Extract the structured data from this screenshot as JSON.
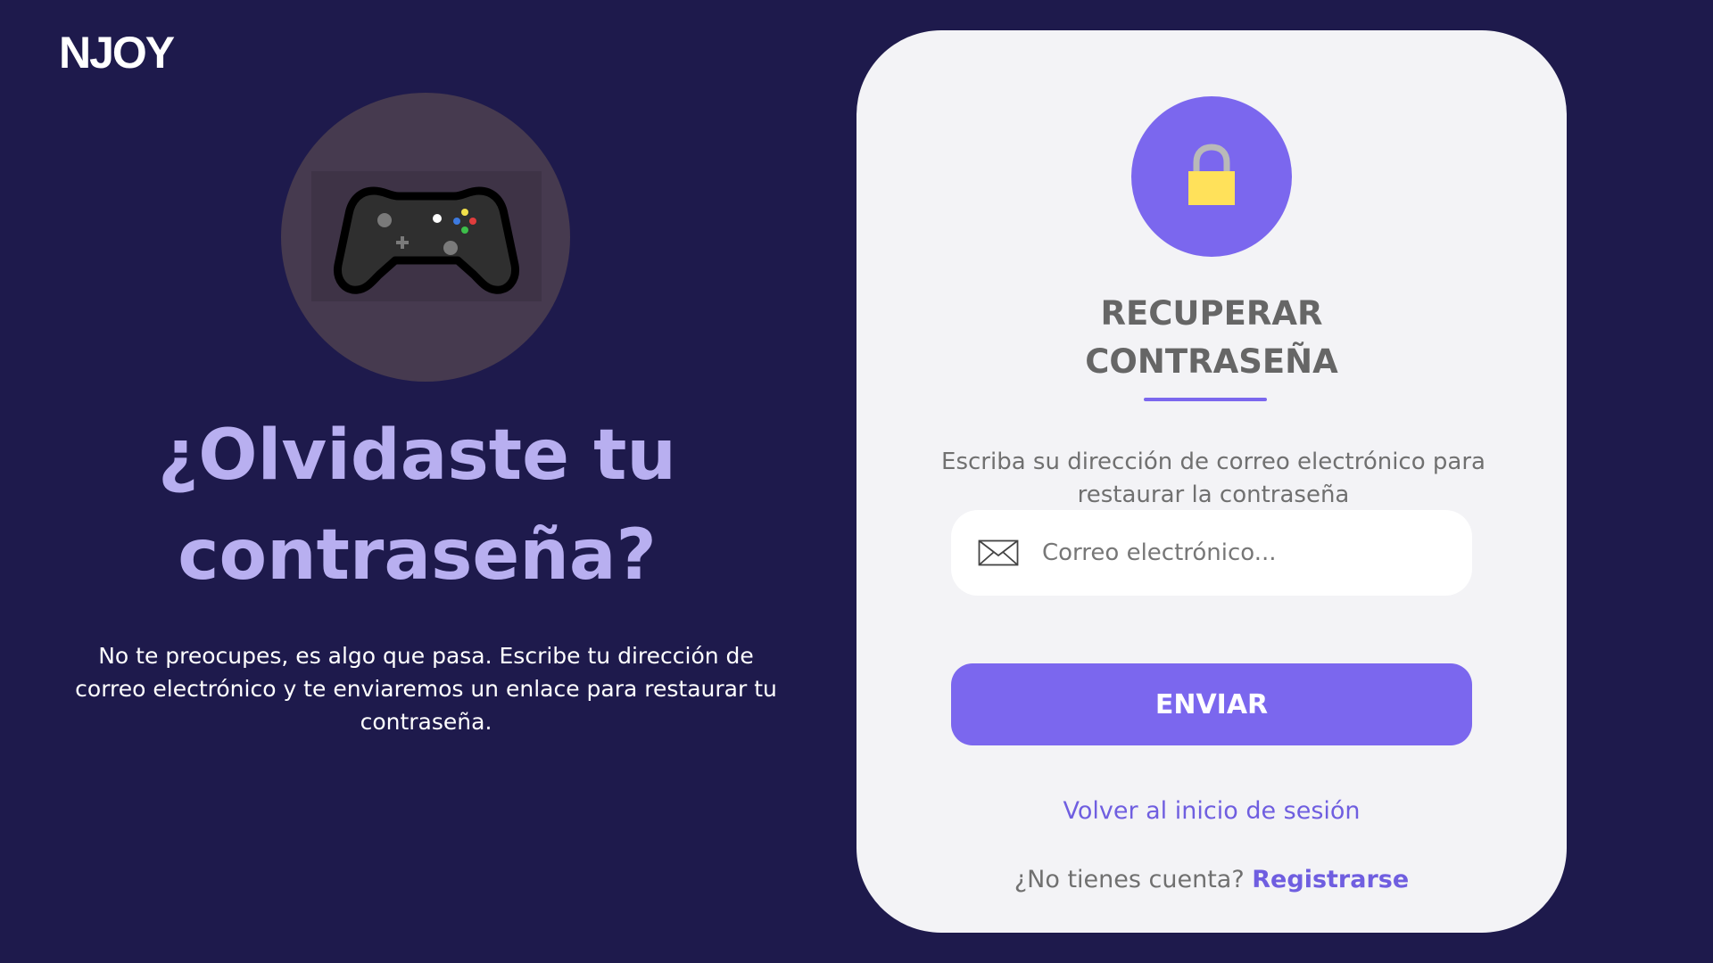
{
  "brand": {
    "logo_text": "NJOY"
  },
  "hero": {
    "image_icon": "gamepad-icon",
    "title_line1": "¿Olvidaste tu",
    "title_line2": "contraseña?",
    "description": "No te preocupes, es algo que pasa. Escribe tu dirección de correo electrónico y te enviaremos un enlace para restaurar tu contraseña."
  },
  "card": {
    "icon": "lock-icon",
    "title_line1": "RECUPERAR",
    "title_line2": "CONTRASEÑA",
    "description": "Escriba su dirección de correo electrónico para restaurar la contraseña",
    "email": {
      "icon": "mail-icon",
      "placeholder": "Correo electrónico...",
      "value": ""
    },
    "submit_label": "ENVIAR",
    "back_link": "Volver al inicio de sesión",
    "signup_prompt": "¿No tienes cuenta?",
    "signup_link": "Registrarse"
  },
  "colors": {
    "background": "#1e1a4c",
    "accent": "#7b67ee",
    "hero_title": "#b8aff0",
    "card_background": "#f3f3f6",
    "lock_body": "#ffe15a"
  }
}
